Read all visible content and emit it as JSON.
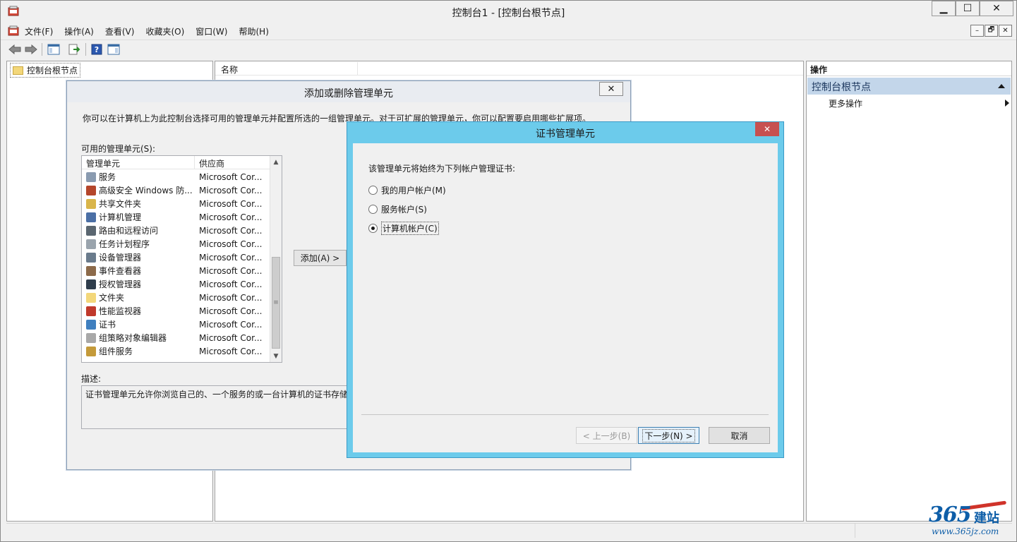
{
  "window": {
    "title": "控制台1 - [控制台根节点]",
    "min_label": "▁",
    "max_label": "☐",
    "close_label": "✕"
  },
  "menubar": {
    "items": [
      "文件(F)",
      "操作(A)",
      "查看(V)",
      "收藏夹(O)",
      "窗口(W)",
      "帮助(H)"
    ],
    "mdi": [
      "–",
      "🗗",
      "✕"
    ]
  },
  "toolbar": {
    "icons": [
      "back-arrow-icon",
      "forward-arrow-icon",
      "show-hide-console-tree-icon",
      "export-list-icon",
      "help-icon",
      "show-hide-action-pane-icon"
    ]
  },
  "tree": {
    "root_label": "控制台根节点"
  },
  "center": {
    "column_name": "名称"
  },
  "actions": {
    "title": "操作",
    "section": "控制台根节点",
    "more": "更多操作"
  },
  "dialog_add_remove": {
    "title": "添加或删除管理单元",
    "close_label": "✕",
    "intro": "你可以在计算机上为此控制台选择可用的管理单元并配置所选的一组管理单元。对于可扩展的管理单元，你可以配置要启用哪些扩展项。",
    "available_label": "可用的管理单元(S):",
    "col_snapin": "管理单元",
    "col_vendor": "供应商",
    "rows": [
      {
        "name": "服务",
        "vendor": "Microsoft Cor...",
        "color": "#8a9bb0"
      },
      {
        "name": "高级安全 Windows 防...",
        "vendor": "Microsoft Cor...",
        "color": "#b5462b"
      },
      {
        "name": "共享文件夹",
        "vendor": "Microsoft Cor...",
        "color": "#d9b54a"
      },
      {
        "name": "计算机管理",
        "vendor": "Microsoft Cor...",
        "color": "#4b6fa5"
      },
      {
        "name": "路由和远程访问",
        "vendor": "Microsoft Cor...",
        "color": "#5a6670"
      },
      {
        "name": "任务计划程序",
        "vendor": "Microsoft Cor...",
        "color": "#9aa4ad"
      },
      {
        "name": "设备管理器",
        "vendor": "Microsoft Cor...",
        "color": "#6a7b8c"
      },
      {
        "name": "事件查看器",
        "vendor": "Microsoft Cor...",
        "color": "#8c6a4a"
      },
      {
        "name": "授权管理器",
        "vendor": "Microsoft Cor...",
        "color": "#2f3d4c"
      },
      {
        "name": "文件夹",
        "vendor": "Microsoft Cor...",
        "color": "#f3d77a"
      },
      {
        "name": "性能监视器",
        "vendor": "Microsoft Cor...",
        "color": "#c0392b"
      },
      {
        "name": "证书",
        "vendor": "Microsoft Cor...",
        "color": "#3f7fbf"
      },
      {
        "name": "组策略对象编辑器",
        "vendor": "Microsoft Cor...",
        "color": "#a8a8a8"
      },
      {
        "name": "组件服务",
        "vendor": "Microsoft Cor...",
        "color": "#c49a3a"
      }
    ],
    "add_button": "添加(A) >",
    "desc_label": "描述:",
    "desc_text": "证书管理单元允许你浏览自己的、一个服务的或一台计算机的证书存储"
  },
  "dialog_cert": {
    "title": "证书管理单元",
    "close_label": "✕",
    "prompt": "该管理单元将始终为下列帐户管理证书:",
    "options": [
      {
        "label": "我的用户帐户(M)",
        "checked": false
      },
      {
        "label": "服务帐户(S)",
        "checked": false
      },
      {
        "label": "计算机帐户(C)",
        "checked": true
      }
    ],
    "back_button": "< 上一步(B)",
    "next_button": "下一步(N) >",
    "cancel_button": "取消"
  },
  "watermark": {
    "big": "365",
    "cn": "建站",
    "url": "www.365jz.com"
  }
}
